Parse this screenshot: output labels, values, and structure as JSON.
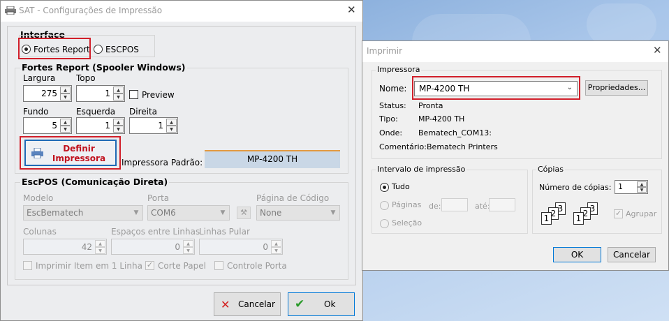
{
  "sat": {
    "title": "SAT - Configurações de Impressão",
    "interface": {
      "label": "Interface",
      "opt_fortes": "Fortes Report",
      "opt_escpos": "ESCPOS"
    },
    "fortes": {
      "title": "Fortes Report (Spooler Windows)",
      "largura_label": "Largura",
      "largura_value": "275",
      "topo_label": "Topo",
      "topo_value": "1",
      "preview_label": "Preview",
      "fundo_label": "Fundo",
      "fundo_value": "5",
      "esquerda_label": "Esquerda",
      "esquerda_value": "1",
      "direita_label": "Direita",
      "direita_value": "1",
      "define_button": "Definir\nImpressora",
      "padrao_label": "Impressora Padrão:",
      "padrao_value": "MP-4200 TH"
    },
    "escpos": {
      "title": "EscPOS (Comunicação Direta)",
      "modelo_label": "Modelo",
      "modelo_value": "EscBematech",
      "porta_label": "Porta",
      "porta_value": "COM6",
      "pagina_label": "Página de Código",
      "pagina_value": "None",
      "colunas_label": "Colunas",
      "colunas_value": "42",
      "espacos_label": "Espaços entre Linhas",
      "espacos_value": "0",
      "linhas_label": "Linhas Pular",
      "linhas_value": "0",
      "imprimir_item_label": "Imprimir Item em 1 Linha",
      "corte_label": "Corte Papel",
      "controle_label": "Controle Porta"
    },
    "buttons": {
      "cancel": "Cancelar",
      "ok": "Ok"
    }
  },
  "print_dialog": {
    "title": "Imprimir",
    "printer_group": "Impressora",
    "nome_label": "Nome:",
    "printer_name": "MP-4200 TH",
    "properties_button": "Propriedades...",
    "status_label": "Status:",
    "status_value": "Pronta",
    "tipo_label": "Tipo:",
    "tipo_value": "MP-4200 TH",
    "onde_label": "Onde:",
    "onde_value": "Bematech_COM13:",
    "comentario_label": "Comentário:",
    "comentario_value": "Bematech Printers",
    "range_group": "Intervalo de impressão",
    "range_all": "Tudo",
    "range_pages": "Páginas",
    "range_from": "de:",
    "range_to": "até:",
    "range_selection": "Seleção",
    "copies_group": "Cópias",
    "copies_label": "Número de cópias:",
    "copies_value": "1",
    "collate_label": "Agrupar",
    "ok_button": "OK",
    "cancel_button": "Cancelar"
  },
  "colors": {
    "highlight": "#d11f2a",
    "define_text": "#c1121f",
    "desktop": "#8fb4e0"
  }
}
